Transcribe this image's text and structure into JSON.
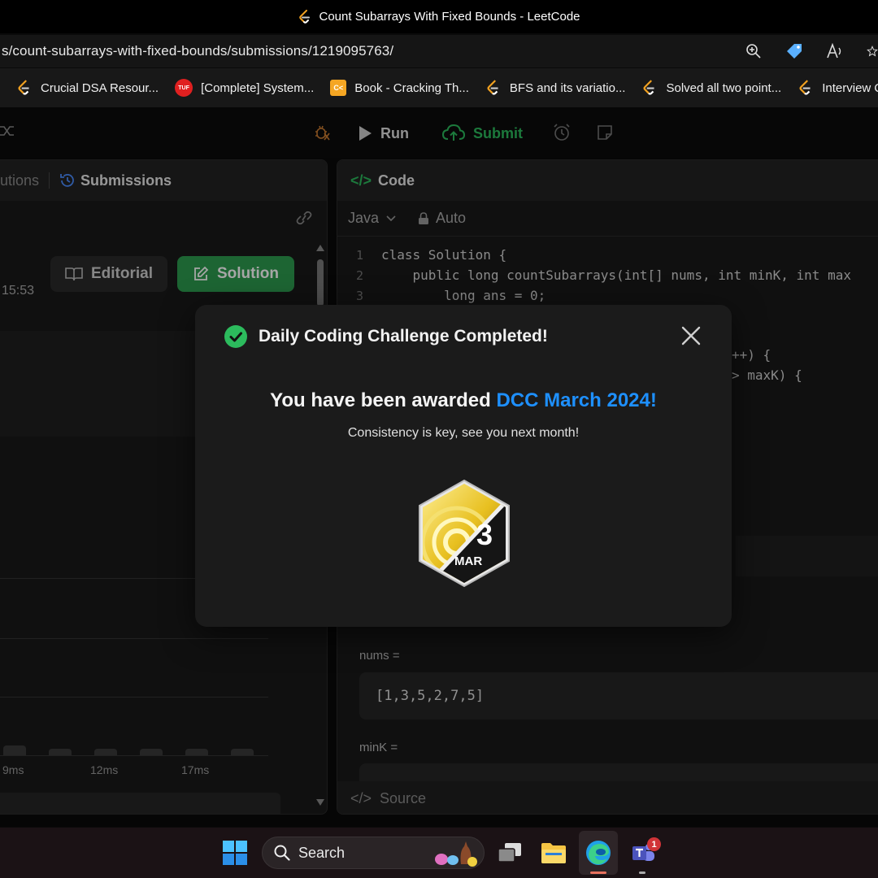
{
  "window": {
    "title": "Count Subarrays With Fixed Bounds - LeetCode"
  },
  "address_bar": {
    "url": "s/count-subarrays-with-fixed-bounds/submissions/1219095763/"
  },
  "bookmarks": [
    {
      "label": "Crucial DSA Resour...",
      "icon": "leetcode-icon"
    },
    {
      "label": "[Complete] System...",
      "icon": "tuf-icon"
    },
    {
      "label": "Book - Cracking Th...",
      "icon": "book-icon"
    },
    {
      "label": "BFS and its variatio...",
      "icon": "leetcode-icon"
    },
    {
      "label": "Solved all two point...",
      "icon": "leetcode-icon"
    },
    {
      "label": "Interview Que",
      "icon": "leetcode-icon"
    }
  ],
  "toolbar": {
    "run_label": "Run",
    "submit_label": "Submit"
  },
  "left_panel": {
    "tab_solutions": "utions",
    "tab_submissions": "Submissions",
    "editorial_label": "Editorial",
    "solution_label": "Solution",
    "time": "15:53",
    "x_ticks": [
      "9ms",
      "12ms",
      "17ms"
    ]
  },
  "right_panel": {
    "header": "Code",
    "language": "Java",
    "mode": "Auto",
    "code_lines": [
      {
        "n": "1",
        "text": "class Solution {"
      },
      {
        "n": "2",
        "text": "    public long countSubarrays(int[] nums, int minK, int max"
      },
      {
        "n": "3",
        "text": "        long ans = 0;"
      }
    ],
    "frag_1": "++) {",
    "frag_2": "> maxK) {",
    "input_label_1": "nums =",
    "input_value_1": "[1,3,5,2,7,5]",
    "input_label_2": "minK =",
    "source_label": "Source"
  },
  "modal": {
    "title": "Daily Coding Challenge Completed!",
    "award_prefix": "You have been awarded ",
    "award_name": "DCC March 2024!",
    "subtext": "Consistency is key, see you next month!",
    "badge_number": "3",
    "badge_month": "MAR"
  },
  "taskbar": {
    "search_label": "Search",
    "teams_badge": "1"
  },
  "colors": {
    "accent_green": "#2cbb5d",
    "link_blue": "#1e90ff"
  }
}
